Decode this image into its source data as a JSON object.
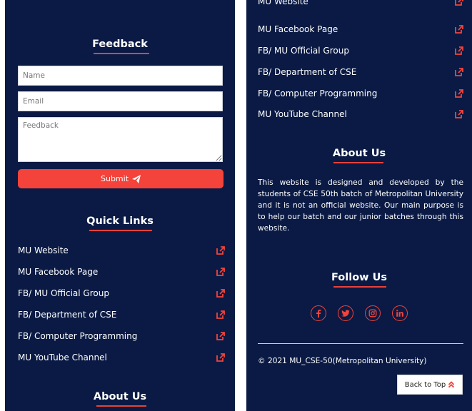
{
  "feedback": {
    "title": "Feedback",
    "name_placeholder": "Name",
    "email_placeholder": "Email",
    "message_placeholder": "Feedback",
    "submit_label": "Submit"
  },
  "quick_links": {
    "title": "Quick Links",
    "items": [
      {
        "label": "MU Website"
      },
      {
        "label": "MU Facebook Page"
      },
      {
        "label": "FB/ MU Official Group"
      },
      {
        "label": "FB/ Department of CSE"
      },
      {
        "label": "FB/ Computer Programming"
      },
      {
        "label": "MU YouTube Channel"
      }
    ]
  },
  "about": {
    "title": "About Us",
    "text": "This website is designed and developed by the students of CSE 50th batch of Metropolitan University and it is not an official website. Our main purpose is to help our batch and our junior batches through this website."
  },
  "follow": {
    "title": "Follow Us",
    "icons": [
      "facebook-icon",
      "twitter-icon",
      "instagram-icon",
      "linkedin-icon"
    ]
  },
  "footer": {
    "copyright": "© 2021 MU_CSE-50(Metropolitan University)",
    "back_to_top": "Back to Top"
  },
  "colors": {
    "background": "#0a1a44",
    "accent": "#f4433a"
  }
}
